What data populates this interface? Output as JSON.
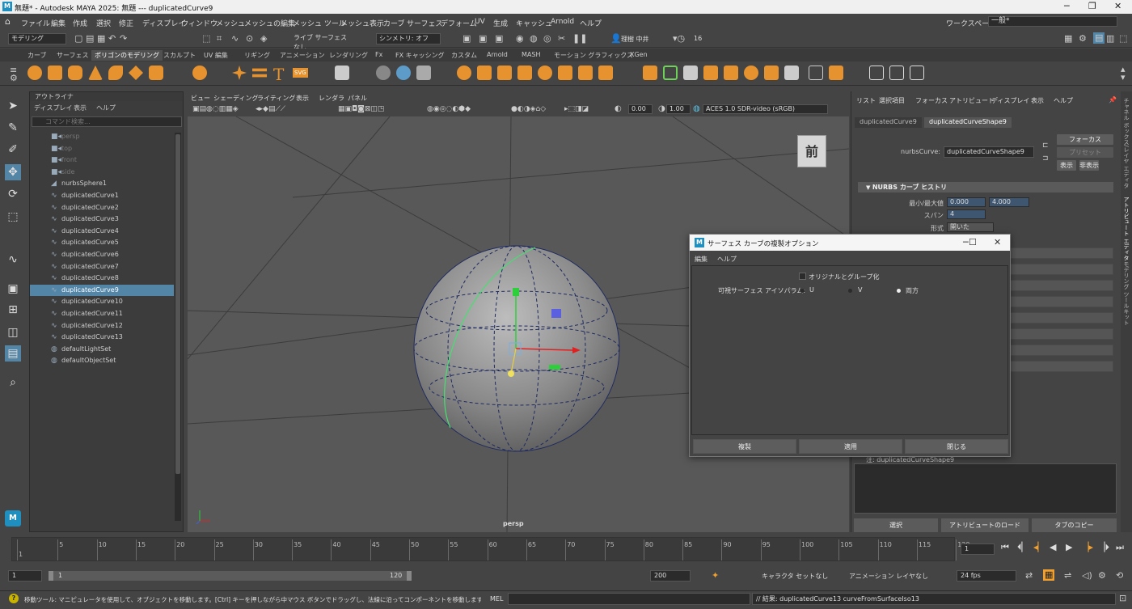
{
  "window": {
    "title": "無題* - Autodesk MAYA 2025: 無題   ---   duplicatedCurve9",
    "app_icon": "M",
    "controls": [
      "─",
      "❐",
      "✕"
    ]
  },
  "menubar": {
    "items": [
      "ファイル",
      "編集",
      "作成",
      "選択",
      "修正",
      "ディスプレイ",
      "ウィンドウ",
      "メッシュ",
      "メッシュの編集",
      "メッシュ ツール",
      "メッシュ表示",
      "カーブ",
      "サーフェス",
      "デフォーム",
      "UV",
      "生成",
      "キャッシュ",
      "Arnold",
      "ヘルプ"
    ],
    "workspace_label": "ワークスペース:",
    "workspace_value": "一般*"
  },
  "statusline": {
    "mode": "モデリング",
    "live": "ライブ サーフェスなし",
    "symmetry": "シンメトリ: オフ",
    "user": "理樹 中井",
    "counter": "16"
  },
  "shelf": {
    "tabs": [
      "カーブ",
      "サーフェス",
      "ポリゴンのモデリング",
      "スカルプト",
      "UV 編集",
      "リギング",
      "アニメーション",
      "レンダリング",
      "Fx",
      "FX キャッシング",
      "カスタム",
      "Arnold",
      "MASH",
      "モーション グラフィックス",
      "XGen"
    ],
    "active_tab": 2,
    "text_icons": [
      "T",
      "SVG"
    ]
  },
  "outliner": {
    "title": "アウトライナ",
    "menu": [
      "ディスプレイ",
      "表示",
      "ヘルプ"
    ],
    "search_placeholder": "コマンド検索...",
    "items": [
      {
        "label": "persp",
        "type": "camera",
        "dim": true
      },
      {
        "label": "top",
        "type": "camera",
        "dim": true
      },
      {
        "label": "front",
        "type": "camera",
        "dim": true
      },
      {
        "label": "side",
        "type": "camera",
        "dim": true
      },
      {
        "label": "nurbsSphere1",
        "type": "nurbs",
        "dim": false
      },
      {
        "label": "duplicatedCurve1",
        "type": "curve",
        "dim": false
      },
      {
        "label": "duplicatedCurve2",
        "type": "curve",
        "dim": false
      },
      {
        "label": "duplicatedCurve3",
        "type": "curve",
        "dim": false
      },
      {
        "label": "duplicatedCurve4",
        "type": "curve",
        "dim": false
      },
      {
        "label": "duplicatedCurve5",
        "type": "curve",
        "dim": false
      },
      {
        "label": "duplicatedCurve6",
        "type": "curve",
        "dim": false
      },
      {
        "label": "duplicatedCurve7",
        "type": "curve",
        "dim": false
      },
      {
        "label": "duplicatedCurve8",
        "type": "curve",
        "dim": false
      },
      {
        "label": "duplicatedCurve9",
        "type": "curve",
        "dim": false,
        "selected": true
      },
      {
        "label": "duplicatedCurve10",
        "type": "curve",
        "dim": false
      },
      {
        "label": "duplicatedCurve11",
        "type": "curve",
        "dim": false
      },
      {
        "label": "duplicatedCurve12",
        "type": "curve",
        "dim": false
      },
      {
        "label": "duplicatedCurve13",
        "type": "curve",
        "dim": false
      },
      {
        "label": "defaultLightSet",
        "type": "set",
        "dim": false
      },
      {
        "label": "defaultObjectSet",
        "type": "set",
        "dim": false
      }
    ]
  },
  "viewport": {
    "menu": [
      "ビュー",
      "シェーディング",
      "ライティング",
      "表示",
      "レンダラ",
      "パネル"
    ],
    "exposure": "0.00",
    "gamma": "1.00",
    "colorspace": "ACES 1.0 SDR-video (sRGB)",
    "camera_label": "persp",
    "viewcube_label": "前"
  },
  "attribute_editor": {
    "menu": [
      "リスト",
      "選択項目",
      "フォーカス",
      "アトリビュート",
      "ディスプレイ",
      "表示",
      "ヘルプ"
    ],
    "tabs": [
      "duplicatedCurve9",
      "duplicatedCurveShape9"
    ],
    "active_tab": 1,
    "node_type_label": "nurbsCurve:",
    "node_name": "duplicatedCurveShape9",
    "buttons": {
      "focus": "フォーカス",
      "preset": "プリセット",
      "show": "表示",
      "hide": "非表示"
    },
    "section_title": "NURBS カーブ ヒストリ",
    "min_max_label": "最小/最大値",
    "min_value": "0.000",
    "max_value": "4.000",
    "span_label": "スパン",
    "span_value": "4",
    "form_label": "形式",
    "form_value": "開いた",
    "notes_label": "注: duplicatedCurveShape9",
    "bottom_buttons": [
      "選択",
      "アトリビュートのロード",
      "タブのコピー"
    ]
  },
  "side_tabs": [
    "チャネル ボックス/レイヤ エディタ",
    "アトリビュート エディタ",
    "モデリング ツールキット"
  ],
  "dialog": {
    "title": "サーフェス カーブの複製オプション",
    "menu": [
      "編集",
      "ヘルプ"
    ],
    "checkbox_label": "オリジナルとグループ化",
    "radio_label": "可視サーフェス アイソパラム:",
    "radio_options": [
      "U",
      "V",
      "両方"
    ],
    "radio_selected": 2,
    "buttons": [
      "複製",
      "適用",
      "閉じる"
    ],
    "controls": [
      "─",
      "☐",
      "✕"
    ]
  },
  "timeline": {
    "ticks": [
      "1",
      "5",
      "10",
      "15",
      "20",
      "25",
      "30",
      "35",
      "40",
      "45",
      "50",
      "55",
      "60",
      "65",
      "70",
      "75",
      "80",
      "85",
      "90",
      "95",
      "100",
      "105",
      "110",
      "115",
      "120"
    ],
    "current_frame": "1"
  },
  "range": {
    "start": "1",
    "inner_start": "1",
    "inner_end": "120",
    "end": "200",
    "character_set": "キャラクタ セットなし",
    "anim_layer": "アニメーション レイヤなし",
    "fps": "24 fps"
  },
  "helpline": {
    "message": "移動ツール: マニピュレータを使用して、オブジェクトを移動します。[Ctrl] キーを押しながら中マウス ボタンでドラッグし、法線に沿ってコンポーネントを移動します。[Shift] キーを押しながらマニピュ",
    "mel_label": "MEL",
    "result": "// 結果: duplicatedCurve13 curveFromSurfaceIso13"
  },
  "colors": {
    "selection": "#5285a6",
    "accent_orange": "#f0a030",
    "maya_blue": "#1e8fbf"
  }
}
